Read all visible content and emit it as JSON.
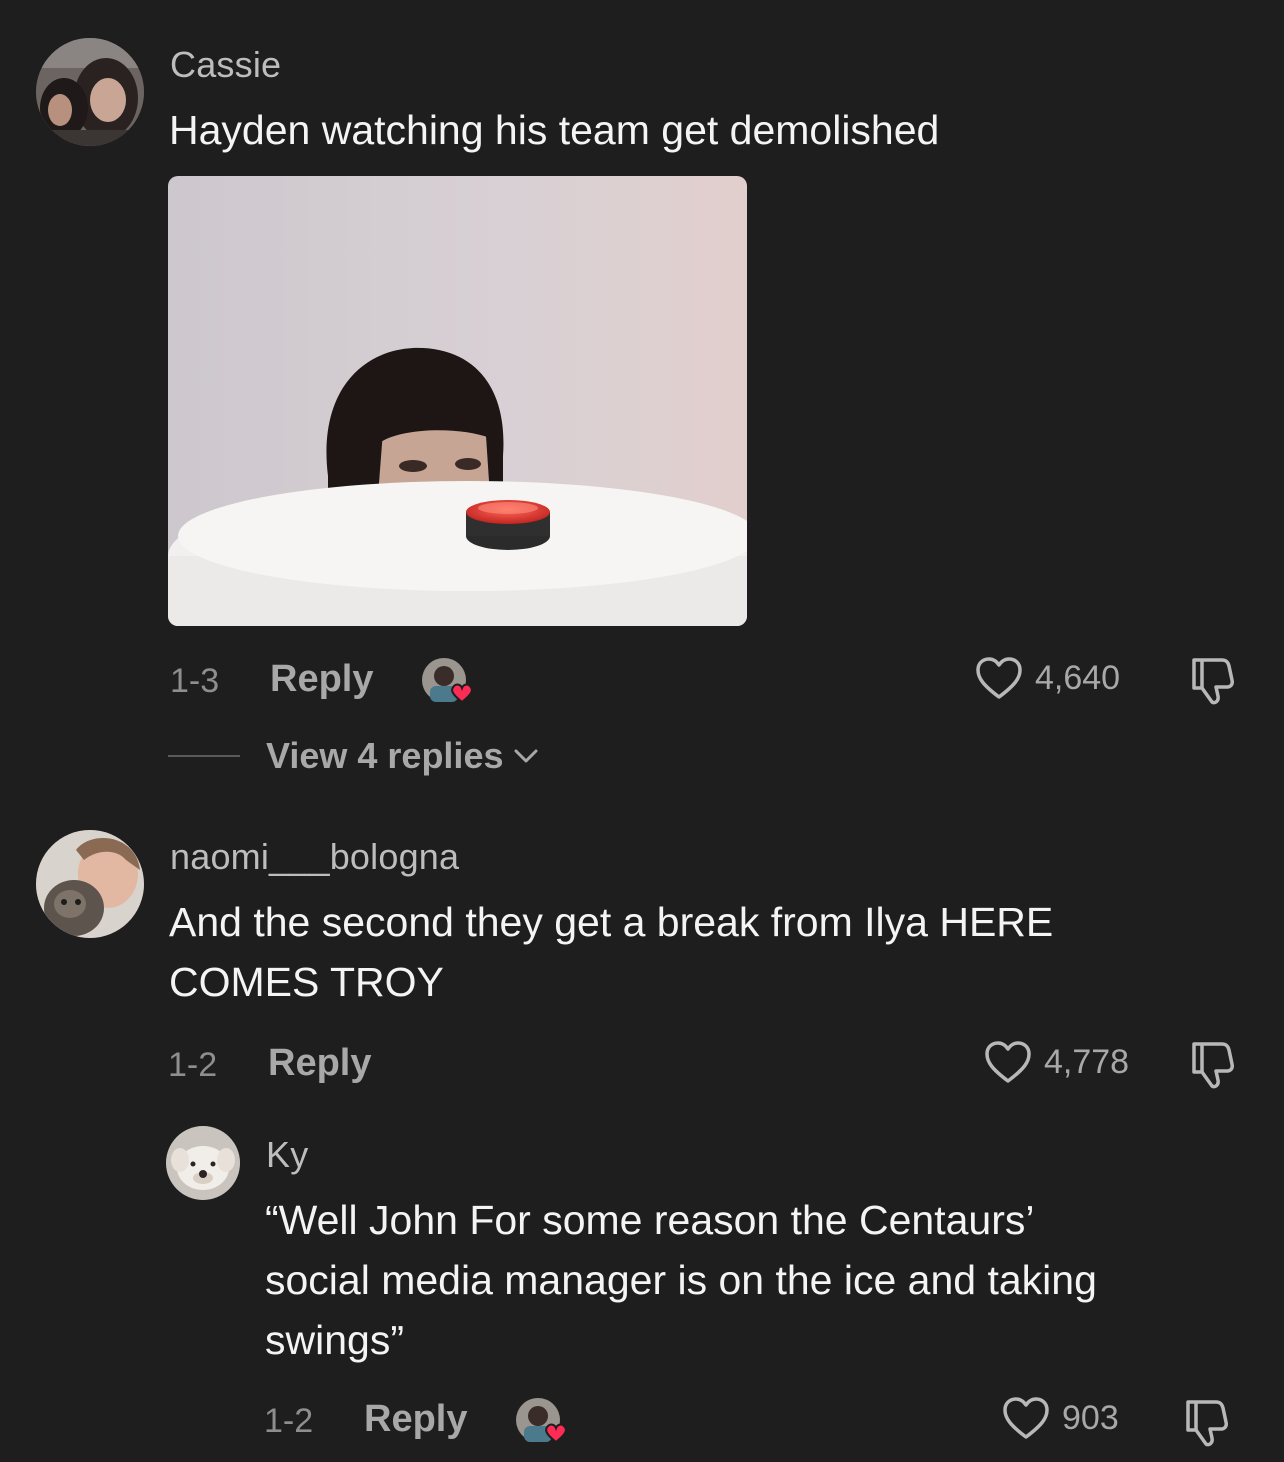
{
  "comments": [
    {
      "username": "Cassie",
      "text": "Hayden watching his team get demolished",
      "date": "1-3",
      "reply_label": "Reply",
      "likes": "4,640",
      "view_replies_label": "View 4 replies"
    },
    {
      "username": "naomi___bologna",
      "text_line1": "And the second they get a break from Ilya HERE",
      "text_line2": "COMES TROY",
      "date": "1-2",
      "reply_label": "Reply",
      "likes": "4,778"
    }
  ],
  "reply": {
    "username": "Ky",
    "text_line1": "“Well John For some reason the Centaurs’",
    "text_line2": "social media manager is on the ice and taking",
    "text_line3": "swings”",
    "date": "1-2",
    "reply_label": "Reply",
    "likes": "903"
  },
  "colors": {
    "background": "#1e1e1e",
    "heart_badge": "#fe2c55",
    "secondary_text": "#a8a8a8"
  },
  "icons": {
    "like": "heart-outline-icon",
    "dislike": "thumbs-down-icon",
    "expand": "chevron-down-icon",
    "creator_liked": "creator-liked-heart-icon"
  }
}
